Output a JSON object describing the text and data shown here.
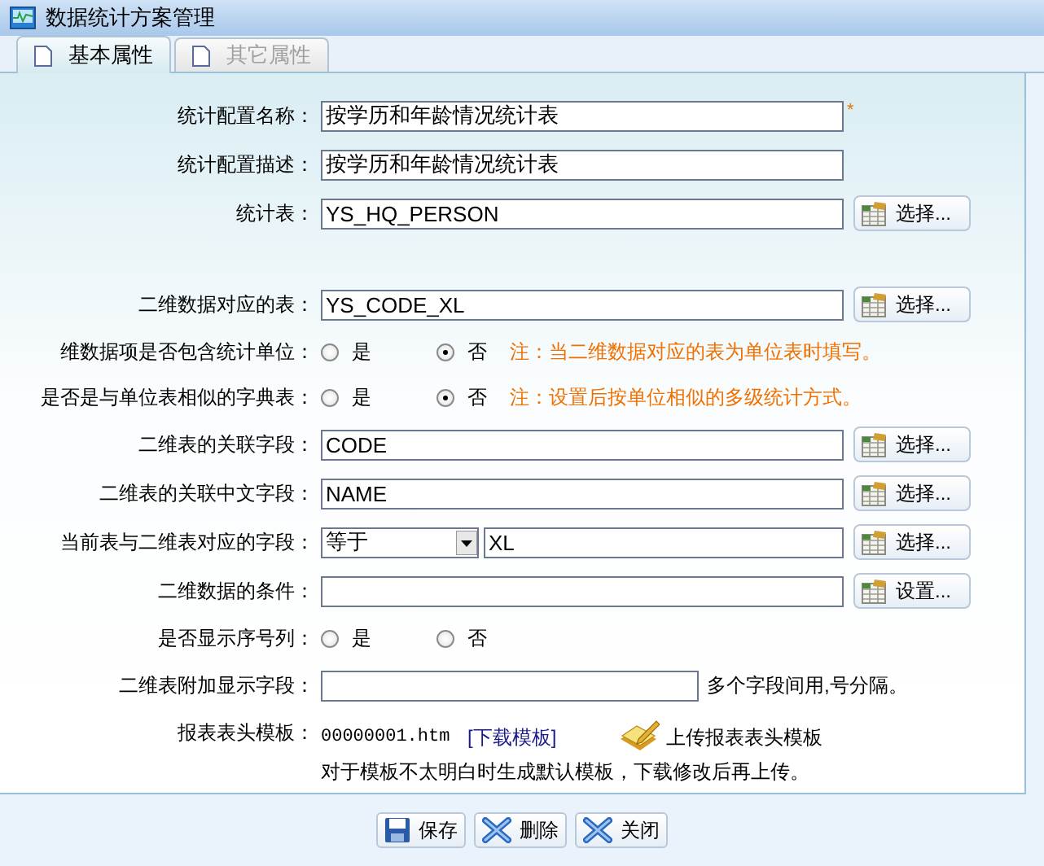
{
  "window": {
    "title": "数据统计方案管理"
  },
  "tabs": [
    {
      "label": "基本属性",
      "selected": true
    },
    {
      "label": "其它属性",
      "selected": false
    }
  ],
  "rows": [
    {
      "kind": "text",
      "label": "统计配置名称：",
      "value": "按学历和年龄情况统计表",
      "marker": "*"
    },
    {
      "kind": "text",
      "label": "统计配置描述：",
      "value": "按学历和年龄情况统计表"
    },
    {
      "kind": "text",
      "label": "统计表：",
      "value": "YS_HQ_PERSON",
      "button": "选择..."
    },
    {
      "kind": "spacer"
    },
    {
      "kind": "text",
      "label": "二维数据对应的表：",
      "value": "YS_CODE_XL",
      "button": "选择..."
    },
    {
      "kind": "radio",
      "label": "维数据项是否包含统计单位：",
      "options": [
        {
          "label": "是",
          "selected": false
        },
        {
          "label": "否",
          "selected": true
        }
      ],
      "note": "注：当二维数据对应的表为单位表时填写。"
    },
    {
      "kind": "radio",
      "label": "是否是与单位表相似的字典表：",
      "options": [
        {
          "label": "是",
          "selected": false
        },
        {
          "label": "否",
          "selected": true
        }
      ],
      "note": "注：设置后按单位相似的多级统计方式。"
    },
    {
      "kind": "text",
      "label": "二维表的关联字段：",
      "value": "CODE",
      "button": "选择..."
    },
    {
      "kind": "text",
      "label": "二维表的关联中文字段：",
      "value": "NAME",
      "button": "选择..."
    },
    {
      "kind": "combo",
      "label": "当前表与二维表对应的字段：",
      "select": "等于",
      "value": "XL",
      "button": "选择..."
    },
    {
      "kind": "text",
      "label": "二维数据的条件：",
      "button": "设置..."
    },
    {
      "kind": "radio",
      "label": "是否显示序号列：",
      "options": [
        {
          "label": "是",
          "selected": false
        },
        {
          "label": "否",
          "selected": false
        }
      ]
    },
    {
      "kind": "short",
      "label": "二维表附加显示字段：",
      "hint": "多个字段间用,号分隔。"
    },
    {
      "kind": "template",
      "label": "报表表头模板：",
      "file": "00000001.htm",
      "link": "[下载模板]",
      "upload": "上传报表表头模板",
      "note": "对于模板不太明白时生成默认模板，下载修改后再上传。"
    }
  ],
  "buttons": [
    {
      "kind": "save",
      "label": "保存"
    },
    {
      "kind": "delete",
      "label": "删除"
    },
    {
      "kind": "close",
      "label": "关闭"
    }
  ]
}
